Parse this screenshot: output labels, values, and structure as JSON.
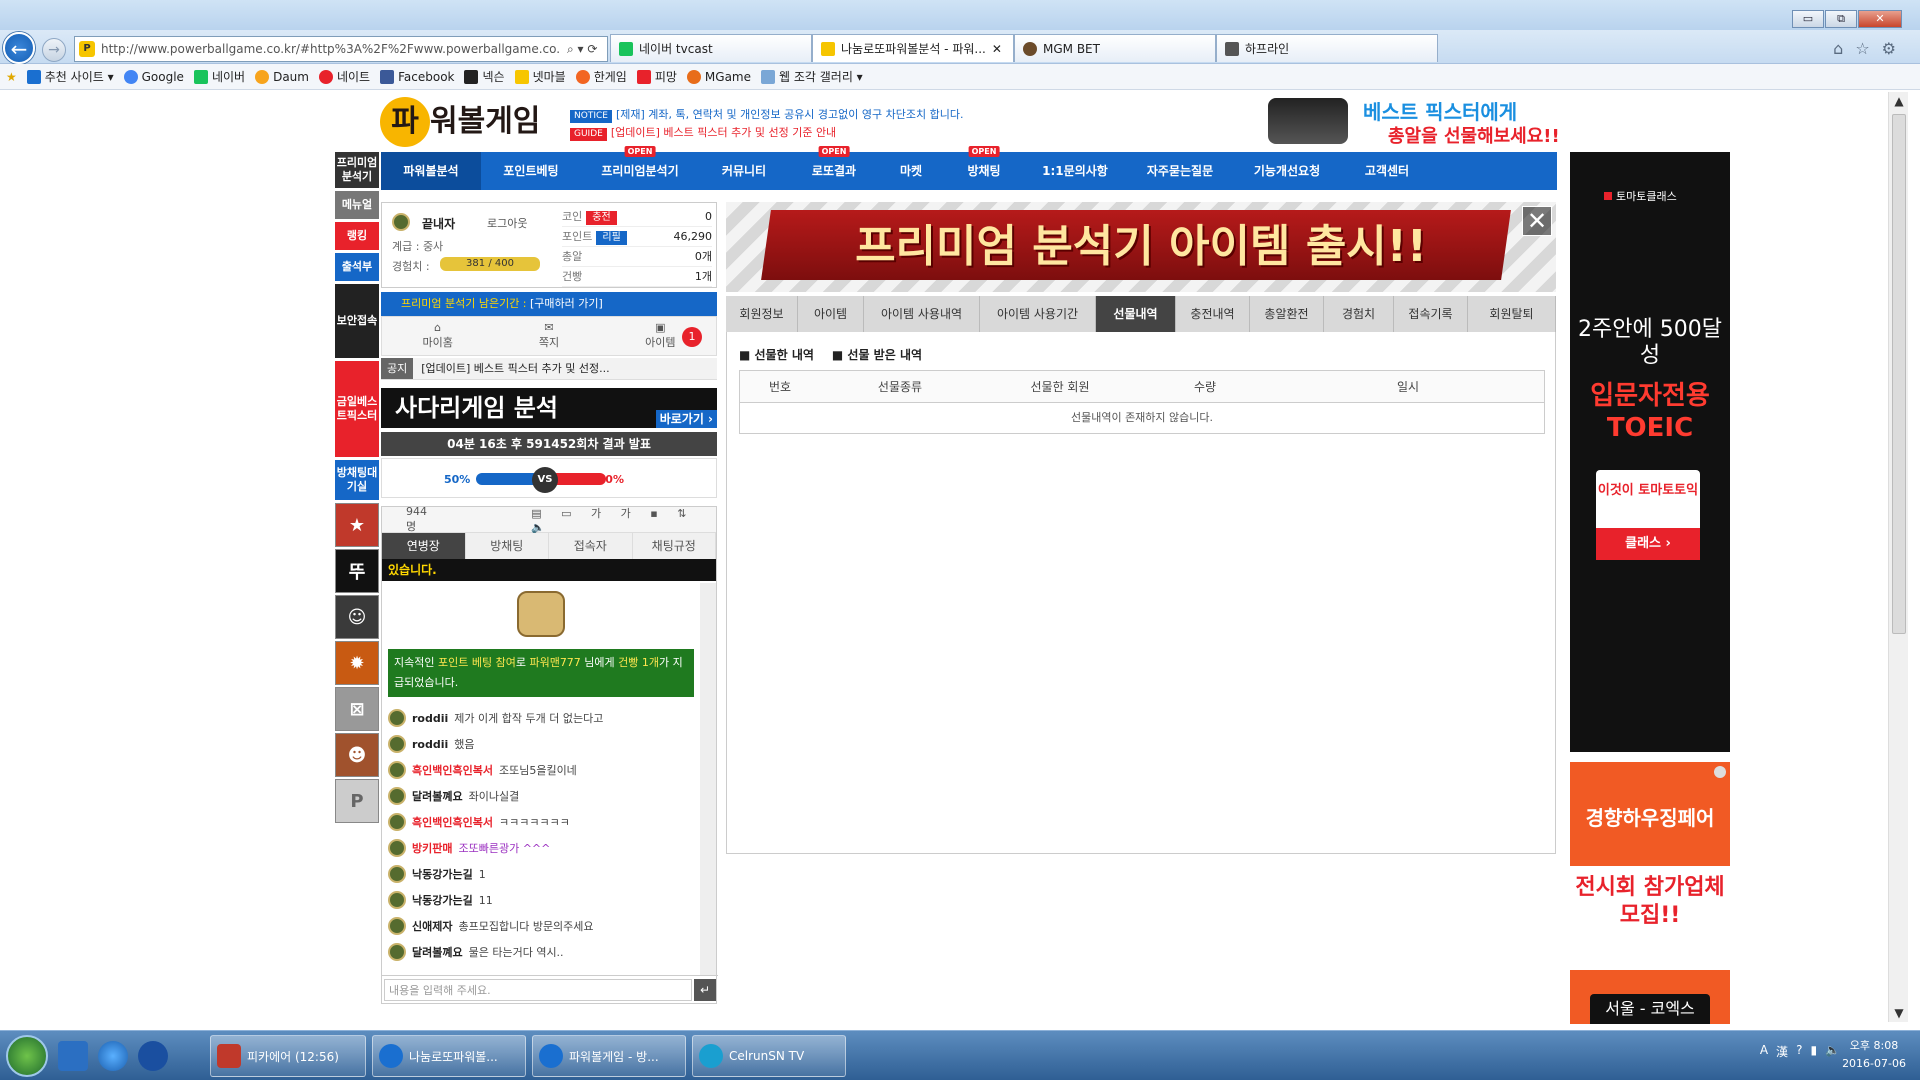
{
  "browser": {
    "url": "http://www.powerballgame.co.kr/#http%3A%2F%2Fwww.powerballgame.co.kr%2F%",
    "tabs": [
      {
        "label": "네이버 tvcast"
      },
      {
        "label": "나눔로또파워볼분석 - 파워..."
      },
      {
        "label": "MGM BET"
      },
      {
        "label": "하프라인"
      }
    ],
    "window_controls": {
      "minimize": "▭",
      "maximize": "⧉",
      "close": "✕"
    },
    "favorites": [
      "추천 사이트 ▾",
      "Google",
      "네이버",
      "Daum",
      "네이트",
      "Facebook",
      "넥슨",
      "넷마블",
      "한게임",
      "피망",
      "MGame",
      "웹 조각 갤러리 ▾"
    ]
  },
  "site": {
    "logo_mark": "파",
    "logo_text": "워볼게임",
    "notices": [
      {
        "tag": "NOTICE",
        "text": "[제재] 계좌, 톡, 연락처 및 개인정보 공유시 경고없이 영구 차단조치 합니다."
      },
      {
        "tag": "GUIDE",
        "text": "[업데이트] 베스트 픽스터 추가 및 선정 기준 안내"
      }
    ],
    "top_ad": {
      "line1": "베스트 픽스터에게",
      "line2": "총알을 선물해보세요!!"
    },
    "nav": [
      {
        "label": "파워볼분석",
        "open": ""
      },
      {
        "label": "포인트베팅",
        "open": ""
      },
      {
        "label": "프리미엄분석기",
        "open": "OPEN"
      },
      {
        "label": "커뮤니티",
        "open": ""
      },
      {
        "label": "로또결과",
        "open": "OPEN"
      },
      {
        "label": "마켓",
        "open": ""
      },
      {
        "label": "방채팅",
        "open": "OPEN"
      },
      {
        "label": "1:1문의사항",
        "open": ""
      },
      {
        "label": "자주묻는질문",
        "open": ""
      },
      {
        "label": "기능개선요청",
        "open": ""
      },
      {
        "label": "고객센터",
        "open": ""
      }
    ],
    "side": [
      "프리미엄분석기",
      "메뉴얼",
      "랭킹",
      "출석부",
      "보안접속",
      "금일베스트픽스터",
      "방채팅대기실"
    ]
  },
  "user": {
    "name": "끝내자",
    "logout": "로그아웃",
    "rank": "계급 : 중사",
    "exp_label": "경험치 :",
    "exp_value": "381 / 400",
    "stats": [
      {
        "label": "코인",
        "pill": "충전",
        "value": "0"
      },
      {
        "label": "포인트",
        "pill": "리필",
        "value": "46,290"
      },
      {
        "label": "총알",
        "pill": "",
        "value": "0개"
      },
      {
        "label": "건빵",
        "pill": "",
        "value": "1개"
      }
    ],
    "premium_text": "프리미엄 분석기 남은기간 : ",
    "premium_link": "[구매하러 가기]",
    "quick": [
      "마이홈",
      "쪽지",
      "아이템"
    ],
    "item_badge": "1",
    "notice_tag": "공지",
    "notice_text": "[업데이트] 베스트 픽스터 추가 및 선정..."
  },
  "ladder": {
    "title": "사다리게임 분석",
    "go": "바로가기 ›"
  },
  "powerball": {
    "result": "04분 16초 후 591452회차 결과 발표",
    "left_pct": "50%",
    "right_pct": "50%",
    "vs": "VS"
  },
  "chat": {
    "users": "944명",
    "tabs": [
      "연병장",
      "방채팅",
      "접속자",
      "채팅규정"
    ],
    "marquee": "있습니다.",
    "system": {
      "pre": "지속적인 ",
      "y1": "포인트 베팅 참여",
      "mid": "로 ",
      "y2": "파워맨777",
      "mid2": " 님에게 ",
      "y3": "건빵 1개",
      "post": "가 지급되었습니다."
    },
    "messages": [
      {
        "nick": "roddii",
        "text": "제가 이게 합작 두개 더 없는다고"
      },
      {
        "nick": "roddii",
        "text": "했음"
      },
      {
        "nick": "흑인백인흑인복서",
        "text": "조또님5을킬이네"
      },
      {
        "nick": "달려볼꼐요",
        "text": "좌이나실결"
      },
      {
        "nick": "흑인백인흑인복서",
        "text": "ㅋㅋㅋㅋㅋㅋㅋ"
      },
      {
        "nick": "방키판매",
        "text": "조또빠른광가 ^^^"
      },
      {
        "nick": "낙동강가는길",
        "text": "1"
      },
      {
        "nick": "낙동강가는길",
        "text": "11"
      },
      {
        "nick": "신애제자",
        "text": "총프모집합니다 방문의주세요"
      },
      {
        "nick": "달려볼꼐요",
        "text": "물은 타는거다 역시.."
      }
    ],
    "placeholder": "내용을 입력해 주세요."
  },
  "main": {
    "banner": "프리미엄 분석기 아이템 출시!!",
    "tabs": [
      "회원정보",
      "아이템",
      "아이템 사용내역",
      "아이템 사용기간",
      "선물내역",
      "충전내역",
      "총알환전",
      "경험치",
      "접속기록",
      "회원탈퇴"
    ],
    "active_tab": "선물내역",
    "sub": [
      "선물한 내역",
      "선물 받은 내역"
    ],
    "columns": [
      "번호",
      "선물종류",
      "선물한 회원",
      "수량",
      "일시"
    ],
    "empty": "선물내역이 존재하지 않습니다."
  },
  "ads": {
    "right1": {
      "brand": "토마토클래스",
      "line1": "2주안에 500달성",
      "line2": "입문자전용 TOEIC",
      "card": "이것이 토마토토익",
      "button": "클래스 ›"
    },
    "right2": {
      "line1": "경향하우징페어",
      "line2": "전시회 참가업체 모집!!",
      "line3": "서울 - 코엑스"
    }
  },
  "taskbar": {
    "items": [
      "피카에어 (12:56)",
      "나눔로또파워볼...",
      "파워볼게임 - 방...",
      "CelrunSN TV"
    ],
    "time": "오후 8:08",
    "date": "2016-07-06"
  },
  "colors": {
    "brand_blue": "#1567c7",
    "brand_red": "#e8222b",
    "brand_yellow": "#f8b500"
  }
}
